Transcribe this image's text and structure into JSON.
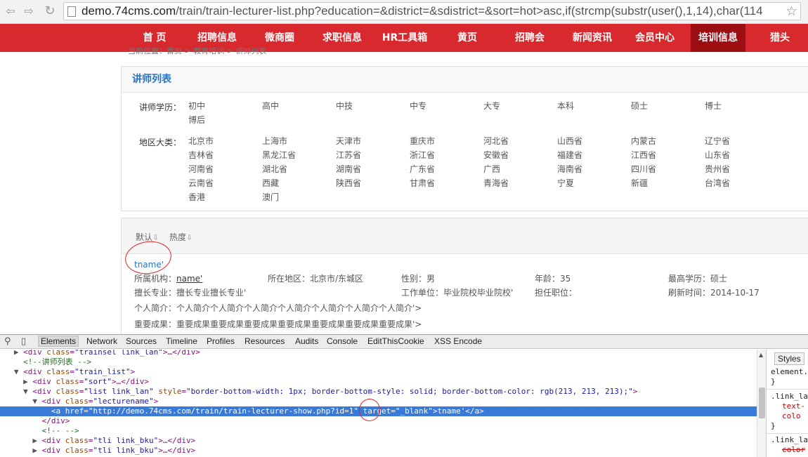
{
  "browser": {
    "url_host": "demo.74cms.com",
    "url_path": "/train/train-lecturer-list.php?education=&district=&sdistrict=&sort=hot>asc,if(strcmp(substr(user(),1,14),char(114",
    "back_icon": "back-arrow-icon",
    "forward_icon": "forward-arrow-icon",
    "reload_icon": "reload-icon",
    "bookmark_icon": "star-icon"
  },
  "site_nav": [
    "首 页",
    "招聘信息",
    "微商圈",
    "求职信息",
    "HR工具箱",
    "黄页",
    "招聘会",
    "新闻资讯",
    "会员中心",
    "培训信息",
    "猎头"
  ],
  "site_nav_active": "培训信息",
  "breadcrumb": "当前位置：首页 > 教育培训 > 讲师列表",
  "panel_title": "讲师列表",
  "education_label": "讲师学历：",
  "education_options": [
    "初中",
    "高中",
    "中技",
    "中专",
    "大专",
    "本科",
    "硕士",
    "博士",
    "博后"
  ],
  "district_label": "地区大类：",
  "district_options": [
    "北京市",
    "上海市",
    "天津市",
    "重庆市",
    "河北省",
    "山西省",
    "内蒙古",
    "辽宁省",
    "吉林省",
    "黑龙江省",
    "江苏省",
    "浙江省",
    "安徽省",
    "福建省",
    "江西省",
    "山东省",
    "河南省",
    "湖北省",
    "湖南省",
    "广东省",
    "广西",
    "海南省",
    "四川省",
    "贵州省",
    "云南省",
    "西藏",
    "陕西省",
    "甘肃省",
    "青海省",
    "宁夏",
    "新疆",
    "台湾省",
    "香港",
    "澳门"
  ],
  "sort": {
    "default_label": "默认",
    "hot_label": "热度",
    "arrow": "⇩"
  },
  "lecturer": {
    "name": "tname'",
    "org_label": "所属机构：",
    "org_value": "name'",
    "area": "所在地区：北京市/东城区",
    "gender": "性别：男",
    "age": "年龄：35",
    "education": "最高学历：硕士",
    "specialty": "擅长专业：擅长专业擅长专业'",
    "workplace": "工作单位：毕业院校毕业院校'",
    "position": "担任职位：",
    "refresh": "刷新时间：2014-10-17",
    "intro": "个人简介：个人简介个人简介个人简介个人简介个人简介个人简介个人简介'>",
    "achievement": "重要成果：重要成果重要成果重要成果重要成果重要成果重要成果重要成果'>"
  },
  "devtools": {
    "tabs": [
      "Elements",
      "Network",
      "Sources",
      "Timeline",
      "Profiles",
      "Resources",
      "Audits",
      "Console",
      "EditThisCookie",
      "XSS Encode"
    ],
    "active_tab": "Elements",
    "styles_tab": "Styles",
    "code": {
      "l0_tag": "<div ",
      "l0_an": "class",
      "l0_av": "\"trainsel link_lan\"",
      "l0_rest": ">…</div>",
      "l1": "<!--讲师列表 -->",
      "l2_tag": "<div ",
      "l2_an": "class",
      "l2_av": "\"train_list\"",
      "l2_end": ">",
      "l3_tag": "<div ",
      "l3_an": "class",
      "l3_av": "\"sort\"",
      "l3_rest": ">…</div>",
      "l4_tag": "<div ",
      "l4_an1": "class",
      "l4_av1": "\"list link_lan\"",
      "l4_an2": " style",
      "l4_av2": "\"border-bottom-width: 1px; border-bottom-style: solid; border-bottom-color: rgb(213, 213, 213);\"",
      "l4_end": ">",
      "l5_tag": "<div ",
      "l5_an": "class",
      "l5_av": "\"lecturename\"",
      "l5_end": ">",
      "l6": "<a href=\"http://demo.74cms.com/train/train-lecturer-show.php?id=1\" target=\"_blank\">tname'</a>",
      "l7": "</div>",
      "l8": "<!-- -->",
      "l9_tag": "<div ",
      "l9_an": "class",
      "l9_av": "\"tli link_bku\"",
      "l9_rest": ">…</div>",
      "l10_tag": "<div ",
      "l10_an": "class",
      "l10_av": "\"tli link_bku\"",
      "l10_rest": ">…</div>"
    },
    "styles": {
      "s1": "element.",
      "s2": "}",
      "s3": ".link_la",
      "s4": "text-",
      "s5": "colo",
      "s6": "}",
      "s7": ".link_la",
      "s8": "color"
    }
  }
}
